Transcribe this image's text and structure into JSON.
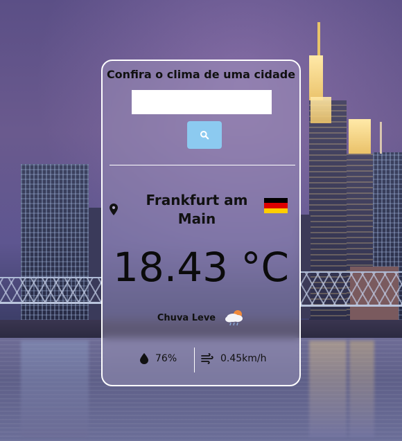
{
  "app": {
    "title": "Confira o clima de uma cidade"
  },
  "search": {
    "value": "",
    "placeholder": "",
    "button_icon": "search-icon"
  },
  "weather": {
    "city": "Frankfurt am Main",
    "country_flag": "flag-germany-icon",
    "temperature": "18.43 °C",
    "description": "Chuva Leve",
    "description_icon": "light-rain-icon",
    "humidity": "76%",
    "humidity_icon": "droplet-icon",
    "wind": "0.45km/h",
    "wind_icon": "wind-icon"
  },
  "colors": {
    "search_button": "#8ccaf0",
    "card_border": "#ffffff",
    "flag_black": "#000000",
    "flag_red": "#dd0000",
    "flag_gold": "#ffce00"
  }
}
